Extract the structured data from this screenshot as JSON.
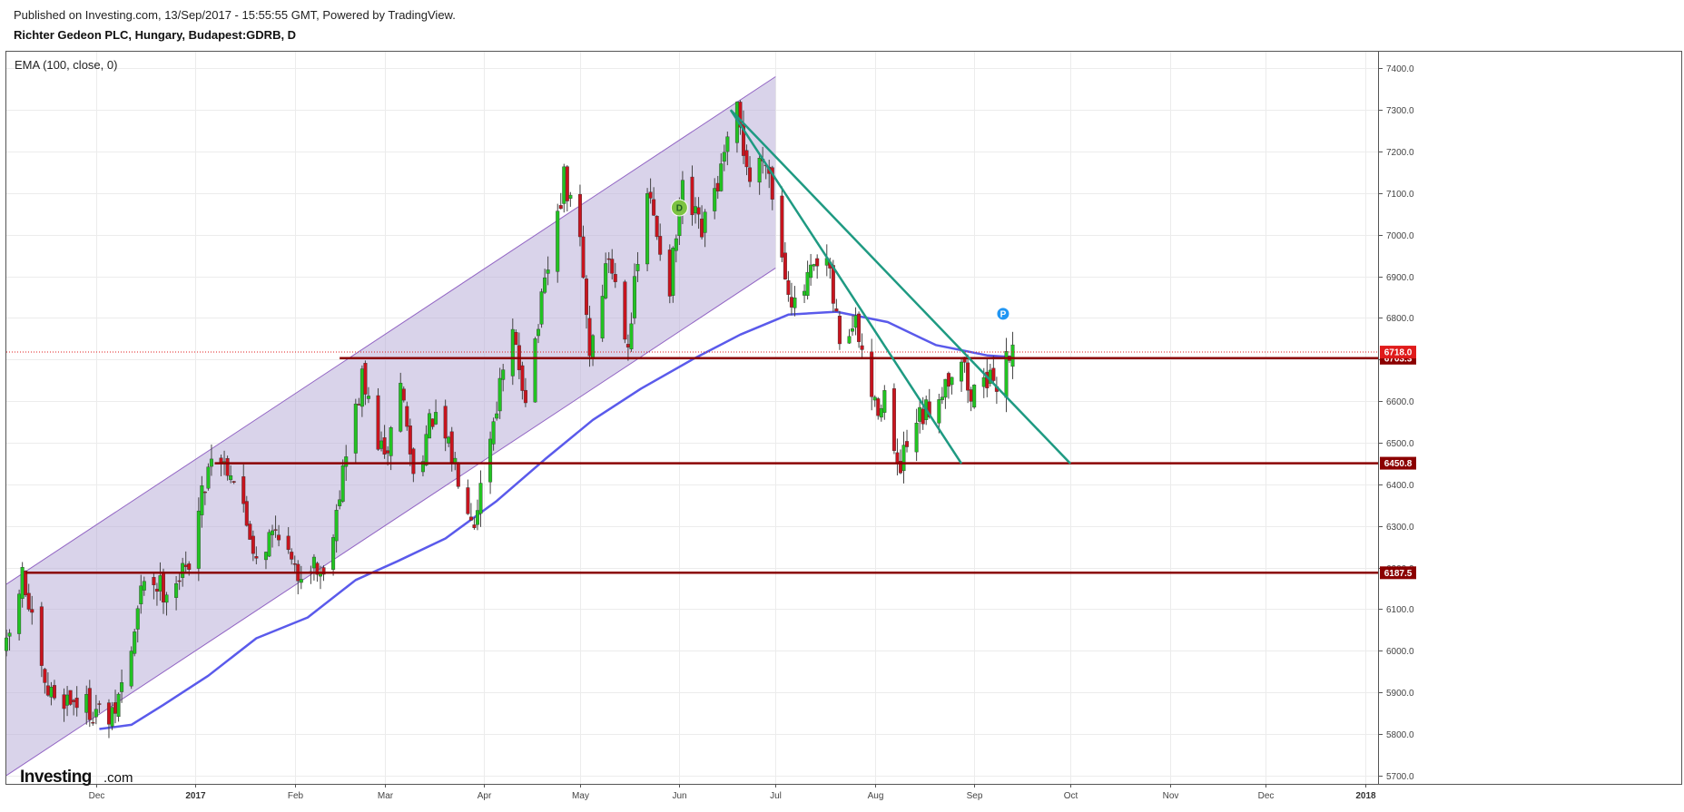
{
  "header": {
    "published": "Published on Investing.com, 13/Sep/2017 - 15:55:55 GMT, Powered by TradingView.",
    "instrument": "Richter Gedeon PLC, Hungary, Budapest:GDRB, D"
  },
  "logo": {
    "brand": "Investing",
    "suffix": ".com"
  },
  "colors": {
    "up": "#22c322",
    "down": "#c8141e",
    "ema": "#5a5aeb",
    "channel_fill": "#b4a7d6",
    "channel_line": "#9265c4",
    "trend": "#1e9a82",
    "level": "#8b0000",
    "current": "#e01b1b"
  },
  "chart_data": {
    "type": "candlestick",
    "title": "Richter Gedeon PLC, Hungary, Budapest:GDRB, D",
    "indicator_label": "EMA (100, close, 0)",
    "y_axis": {
      "ticks": [
        5700,
        5800,
        5900,
        6000,
        6100,
        6200,
        6300,
        6400,
        6500,
        6600,
        6700,
        6800,
        6900,
        7000,
        7100,
        7200,
        7300,
        7400
      ],
      "range": [
        5680,
        7440
      ]
    },
    "x_axis": {
      "range": [
        "2016-11-03",
        "2018-01-05"
      ],
      "ticks": [
        {
          "label": "Dec",
          "date": "2016-12-01",
          "bold": false
        },
        {
          "label": "2017",
          "date": "2017-01-01",
          "bold": true
        },
        {
          "label": "Feb",
          "date": "2017-02-01",
          "bold": false
        },
        {
          "label": "Mar",
          "date": "2017-03-01",
          "bold": false
        },
        {
          "label": "Apr",
          "date": "2017-04-01",
          "bold": false
        },
        {
          "label": "May",
          "date": "2017-05-01",
          "bold": false
        },
        {
          "label": "Jun",
          "date": "2017-06-01",
          "bold": false
        },
        {
          "label": "Jul",
          "date": "2017-07-01",
          "bold": false
        },
        {
          "label": "Aug",
          "date": "2017-08-01",
          "bold": false
        },
        {
          "label": "Sep",
          "date": "2017-09-01",
          "bold": false
        },
        {
          "label": "Oct",
          "date": "2017-10-01",
          "bold": false
        },
        {
          "label": "Nov",
          "date": "2017-11-01",
          "bold": false
        },
        {
          "label": "Dec",
          "date": "2017-12-01",
          "bold": false
        },
        {
          "label": "2018",
          "date": "2018-01-01",
          "bold": true
        }
      ]
    },
    "price_path": [
      [
        "2016-11-03",
        6000
      ],
      [
        "2016-11-08",
        6180
      ],
      [
        "2016-11-15",
        5900
      ],
      [
        "2016-11-25",
        5880
      ],
      [
        "2016-12-02",
        5850
      ],
      [
        "2016-12-06",
        5830
      ],
      [
        "2016-12-12",
        6000
      ],
      [
        "2016-12-16",
        6180
      ],
      [
        "2016-12-22",
        6150
      ],
      [
        "2016-12-29",
        6190
      ],
      [
        "2017-01-06",
        6480
      ],
      [
        "2017-01-12",
        6440
      ],
      [
        "2017-01-20",
        6230
      ],
      [
        "2017-01-27",
        6300
      ],
      [
        "2017-02-01",
        6180
      ],
      [
        "2017-02-06",
        6220
      ],
      [
        "2017-02-10",
        6180
      ],
      [
        "2017-02-16",
        6430
      ],
      [
        "2017-02-22",
        6650
      ],
      [
        "2017-03-01",
        6450
      ],
      [
        "2017-03-06",
        6650
      ],
      [
        "2017-03-10",
        6420
      ],
      [
        "2017-03-16",
        6560
      ],
      [
        "2017-03-23",
        6450
      ],
      [
        "2017-03-29",
        6320
      ],
      [
        "2017-04-05",
        6600
      ],
      [
        "2017-04-10",
        6750
      ],
      [
        "2017-04-14",
        6620
      ],
      [
        "2017-04-20",
        6870
      ],
      [
        "2017-04-26",
        7130
      ],
      [
        "2017-05-01",
        6980
      ],
      [
        "2017-05-04",
        6720
      ],
      [
        "2017-05-10",
        6950
      ],
      [
        "2017-05-16",
        6750
      ],
      [
        "2017-05-22",
        7100
      ],
      [
        "2017-05-29",
        6880
      ],
      [
        "2017-06-02",
        7100
      ],
      [
        "2017-06-08",
        7000
      ],
      [
        "2017-06-14",
        7150
      ],
      [
        "2017-06-19",
        7290
      ],
      [
        "2017-06-23",
        7130
      ],
      [
        "2017-06-28",
        7200
      ],
      [
        "2017-07-03",
        6950
      ],
      [
        "2017-07-07",
        6820
      ],
      [
        "2017-07-12",
        6900
      ],
      [
        "2017-07-17",
        6930
      ],
      [
        "2017-07-21",
        6750
      ],
      [
        "2017-07-26",
        6780
      ],
      [
        "2017-08-01",
        6580
      ],
      [
        "2017-08-04",
        6620
      ],
      [
        "2017-08-08",
        6420
      ],
      [
        "2017-08-14",
        6540
      ],
      [
        "2017-08-18",
        6580
      ],
      [
        "2017-08-23",
        6650
      ],
      [
        "2017-08-28",
        6710
      ],
      [
        "2017-08-31",
        6600
      ],
      [
        "2017-09-04",
        6680
      ],
      [
        "2017-09-07",
        6620
      ],
      [
        "2017-09-11",
        6720
      ],
      [
        "2017-09-13",
        6718
      ]
    ],
    "ema_100": [
      [
        "2016-12-02",
        5812
      ],
      [
        "2016-12-12",
        5822
      ],
      [
        "2016-12-22",
        5870
      ],
      [
        "2017-01-05",
        5940
      ],
      [
        "2017-01-20",
        6030
      ],
      [
        "2017-02-05",
        6080
      ],
      [
        "2017-02-20",
        6170
      ],
      [
        "2017-03-05",
        6215
      ],
      [
        "2017-03-20",
        6270
      ],
      [
        "2017-04-05",
        6360
      ],
      [
        "2017-04-20",
        6460
      ],
      [
        "2017-05-05",
        6555
      ],
      [
        "2017-05-20",
        6630
      ],
      [
        "2017-06-05",
        6700
      ],
      [
        "2017-06-20",
        6760
      ],
      [
        "2017-07-05",
        6808
      ],
      [
        "2017-07-20",
        6815
      ],
      [
        "2017-08-05",
        6790
      ],
      [
        "2017-08-20",
        6735
      ],
      [
        "2017-09-05",
        6710
      ],
      [
        "2017-09-13",
        6706
      ]
    ],
    "channel": {
      "lower_start": [
        "2016-11-03",
        5700
      ],
      "lower_end": [
        "2017-07-01",
        6920
      ],
      "upper_start": [
        "2016-11-03",
        6160
      ],
      "upper_end": [
        "2017-07-01",
        7380
      ]
    },
    "trendlines": [
      {
        "from": [
          "2017-06-17",
          7300
        ],
        "to": [
          "2017-08-28",
          6450
        ]
      },
      {
        "from": [
          "2017-06-17",
          7300
        ],
        "to": [
          "2017-10-01",
          6450
        ]
      }
    ],
    "levels": [
      {
        "value": 6703.3,
        "label": "6703.3",
        "from": "2017-02-15"
      },
      {
        "value": 6450.8,
        "label": "6450.8",
        "from": "2017-01-07"
      },
      {
        "value": 6187.5,
        "label": "6187.5",
        "from": "2016-11-09"
      }
    ],
    "current_price": {
      "value": 6718.0,
      "label": "6718.0"
    },
    "markers": [
      {
        "label": "D",
        "date": "2017-06-01",
        "value": 7065,
        "color": "#7cc242"
      },
      {
        "label": "P",
        "date": "2017-09-10",
        "value": 6810,
        "color": "#2196f3"
      }
    ]
  }
}
